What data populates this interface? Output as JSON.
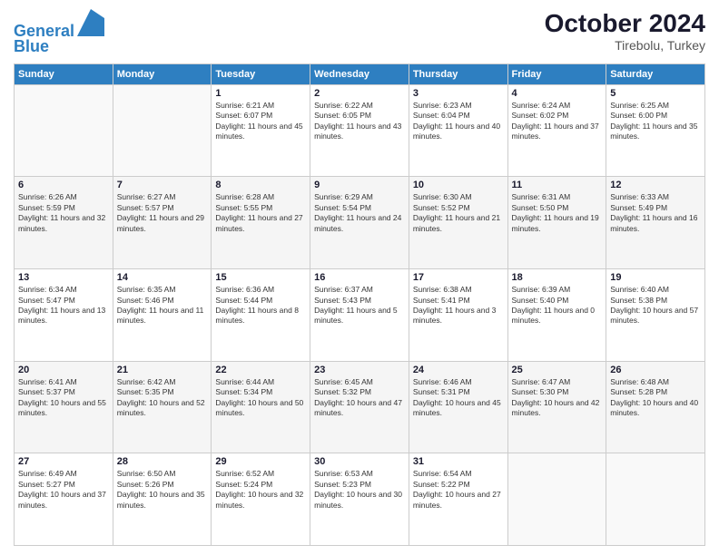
{
  "header": {
    "logo_line1": "General",
    "logo_line2": "Blue",
    "month": "October 2024",
    "location": "Tirebolu, Turkey"
  },
  "days_of_week": [
    "Sunday",
    "Monday",
    "Tuesday",
    "Wednesday",
    "Thursday",
    "Friday",
    "Saturday"
  ],
  "weeks": [
    [
      {
        "day": "",
        "info": ""
      },
      {
        "day": "",
        "info": ""
      },
      {
        "day": "1",
        "info": "Sunrise: 6:21 AM\nSunset: 6:07 PM\nDaylight: 11 hours and 45 minutes."
      },
      {
        "day": "2",
        "info": "Sunrise: 6:22 AM\nSunset: 6:05 PM\nDaylight: 11 hours and 43 minutes."
      },
      {
        "day": "3",
        "info": "Sunrise: 6:23 AM\nSunset: 6:04 PM\nDaylight: 11 hours and 40 minutes."
      },
      {
        "day": "4",
        "info": "Sunrise: 6:24 AM\nSunset: 6:02 PM\nDaylight: 11 hours and 37 minutes."
      },
      {
        "day": "5",
        "info": "Sunrise: 6:25 AM\nSunset: 6:00 PM\nDaylight: 11 hours and 35 minutes."
      }
    ],
    [
      {
        "day": "6",
        "info": "Sunrise: 6:26 AM\nSunset: 5:59 PM\nDaylight: 11 hours and 32 minutes."
      },
      {
        "day": "7",
        "info": "Sunrise: 6:27 AM\nSunset: 5:57 PM\nDaylight: 11 hours and 29 minutes."
      },
      {
        "day": "8",
        "info": "Sunrise: 6:28 AM\nSunset: 5:55 PM\nDaylight: 11 hours and 27 minutes."
      },
      {
        "day": "9",
        "info": "Sunrise: 6:29 AM\nSunset: 5:54 PM\nDaylight: 11 hours and 24 minutes."
      },
      {
        "day": "10",
        "info": "Sunrise: 6:30 AM\nSunset: 5:52 PM\nDaylight: 11 hours and 21 minutes."
      },
      {
        "day": "11",
        "info": "Sunrise: 6:31 AM\nSunset: 5:50 PM\nDaylight: 11 hours and 19 minutes."
      },
      {
        "day": "12",
        "info": "Sunrise: 6:33 AM\nSunset: 5:49 PM\nDaylight: 11 hours and 16 minutes."
      }
    ],
    [
      {
        "day": "13",
        "info": "Sunrise: 6:34 AM\nSunset: 5:47 PM\nDaylight: 11 hours and 13 minutes."
      },
      {
        "day": "14",
        "info": "Sunrise: 6:35 AM\nSunset: 5:46 PM\nDaylight: 11 hours and 11 minutes."
      },
      {
        "day": "15",
        "info": "Sunrise: 6:36 AM\nSunset: 5:44 PM\nDaylight: 11 hours and 8 minutes."
      },
      {
        "day": "16",
        "info": "Sunrise: 6:37 AM\nSunset: 5:43 PM\nDaylight: 11 hours and 5 minutes."
      },
      {
        "day": "17",
        "info": "Sunrise: 6:38 AM\nSunset: 5:41 PM\nDaylight: 11 hours and 3 minutes."
      },
      {
        "day": "18",
        "info": "Sunrise: 6:39 AM\nSunset: 5:40 PM\nDaylight: 11 hours and 0 minutes."
      },
      {
        "day": "19",
        "info": "Sunrise: 6:40 AM\nSunset: 5:38 PM\nDaylight: 10 hours and 57 minutes."
      }
    ],
    [
      {
        "day": "20",
        "info": "Sunrise: 6:41 AM\nSunset: 5:37 PM\nDaylight: 10 hours and 55 minutes."
      },
      {
        "day": "21",
        "info": "Sunrise: 6:42 AM\nSunset: 5:35 PM\nDaylight: 10 hours and 52 minutes."
      },
      {
        "day": "22",
        "info": "Sunrise: 6:44 AM\nSunset: 5:34 PM\nDaylight: 10 hours and 50 minutes."
      },
      {
        "day": "23",
        "info": "Sunrise: 6:45 AM\nSunset: 5:32 PM\nDaylight: 10 hours and 47 minutes."
      },
      {
        "day": "24",
        "info": "Sunrise: 6:46 AM\nSunset: 5:31 PM\nDaylight: 10 hours and 45 minutes."
      },
      {
        "day": "25",
        "info": "Sunrise: 6:47 AM\nSunset: 5:30 PM\nDaylight: 10 hours and 42 minutes."
      },
      {
        "day": "26",
        "info": "Sunrise: 6:48 AM\nSunset: 5:28 PM\nDaylight: 10 hours and 40 minutes."
      }
    ],
    [
      {
        "day": "27",
        "info": "Sunrise: 6:49 AM\nSunset: 5:27 PM\nDaylight: 10 hours and 37 minutes."
      },
      {
        "day": "28",
        "info": "Sunrise: 6:50 AM\nSunset: 5:26 PM\nDaylight: 10 hours and 35 minutes."
      },
      {
        "day": "29",
        "info": "Sunrise: 6:52 AM\nSunset: 5:24 PM\nDaylight: 10 hours and 32 minutes."
      },
      {
        "day": "30",
        "info": "Sunrise: 6:53 AM\nSunset: 5:23 PM\nDaylight: 10 hours and 30 minutes."
      },
      {
        "day": "31",
        "info": "Sunrise: 6:54 AM\nSunset: 5:22 PM\nDaylight: 10 hours and 27 minutes."
      },
      {
        "day": "",
        "info": ""
      },
      {
        "day": "",
        "info": ""
      }
    ]
  ]
}
